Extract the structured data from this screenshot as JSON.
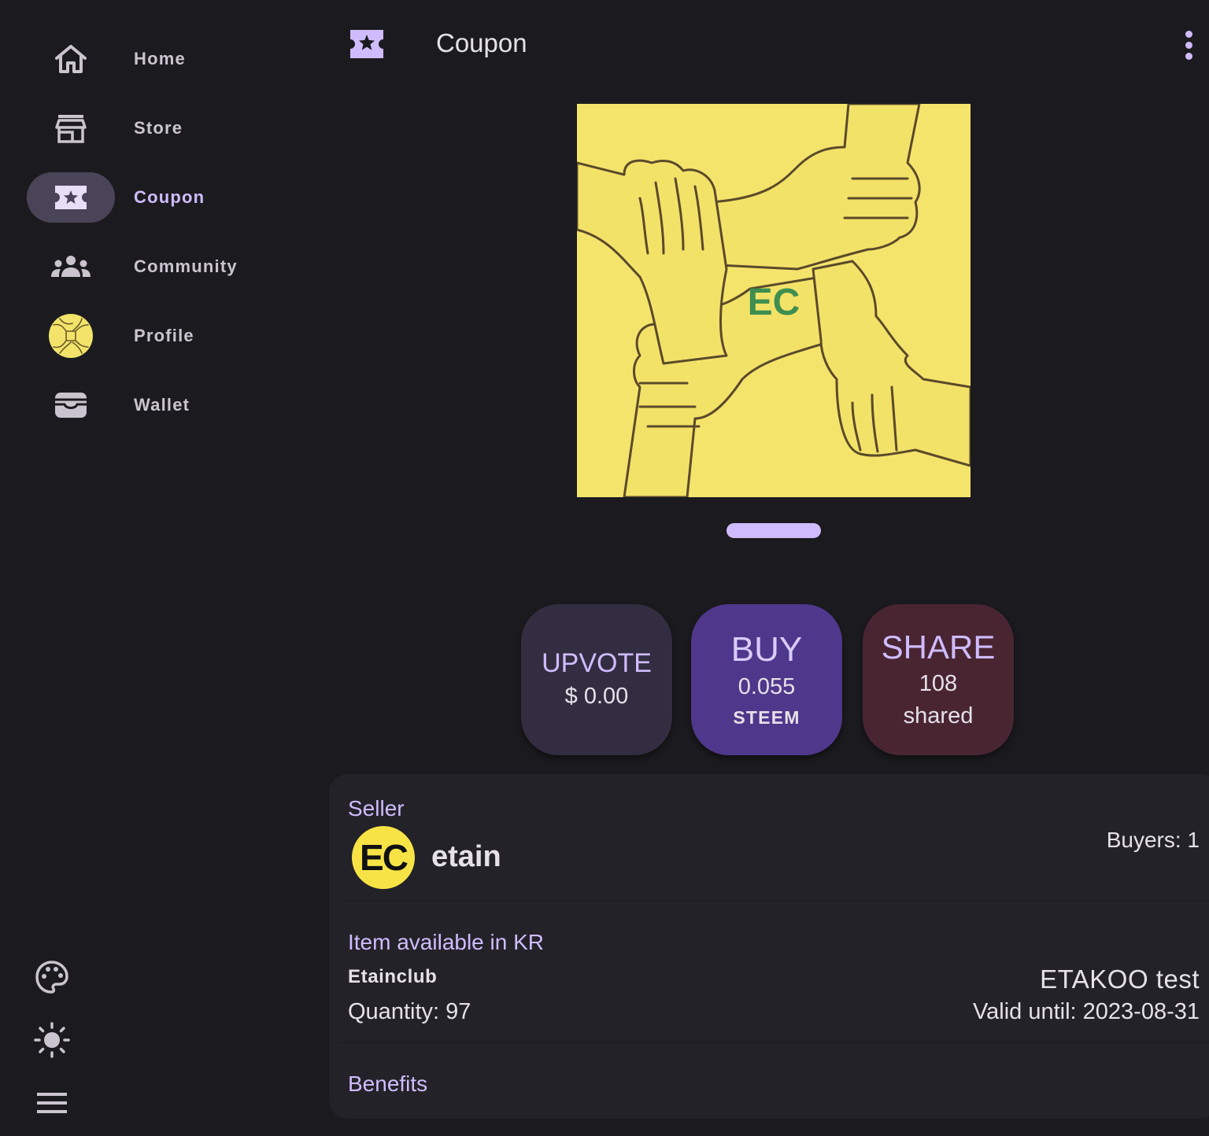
{
  "nav": {
    "items": [
      {
        "label": "Home",
        "icon": "home-icon"
      },
      {
        "label": "Store",
        "icon": "store-icon"
      },
      {
        "label": "Coupon",
        "icon": "coupon-icon",
        "active": true
      },
      {
        "label": "Community",
        "icon": "community-icon"
      },
      {
        "label": "Profile",
        "icon": "profile-avatar"
      },
      {
        "label": "Wallet",
        "icon": "wallet-icon"
      }
    ],
    "bottom_icons": [
      "palette-icon",
      "brightness-icon",
      "menu-icon"
    ]
  },
  "topbar": {
    "title": "Coupon",
    "icon": "coupon-icon"
  },
  "hero": {
    "image_text": "EC"
  },
  "actions": {
    "upvote": {
      "title": "UPVOTE",
      "value": "$ 0.00"
    },
    "buy": {
      "title": "BUY",
      "amount": "0.055",
      "currency": "STEEM"
    },
    "share": {
      "title": "SHARE",
      "count": "108",
      "suffix": "shared"
    }
  },
  "details": {
    "seller_heading": "Seller",
    "seller_avatar_text": "EC",
    "seller_name": "etain",
    "buyers": "Buyers: 1",
    "availability_heading": "Item available in KR",
    "store_name": "Etainclub",
    "quantity": "Quantity: 97",
    "item_title": "ETAKOO test",
    "valid_until": "Valid until: 2023-08-31",
    "benefits_heading": "Benefits"
  },
  "colors": {
    "background": "#1b1b1f",
    "accent": "#cfbcff",
    "hero_bg": "#f5e46b",
    "ec_green": "#3e8e50"
  }
}
